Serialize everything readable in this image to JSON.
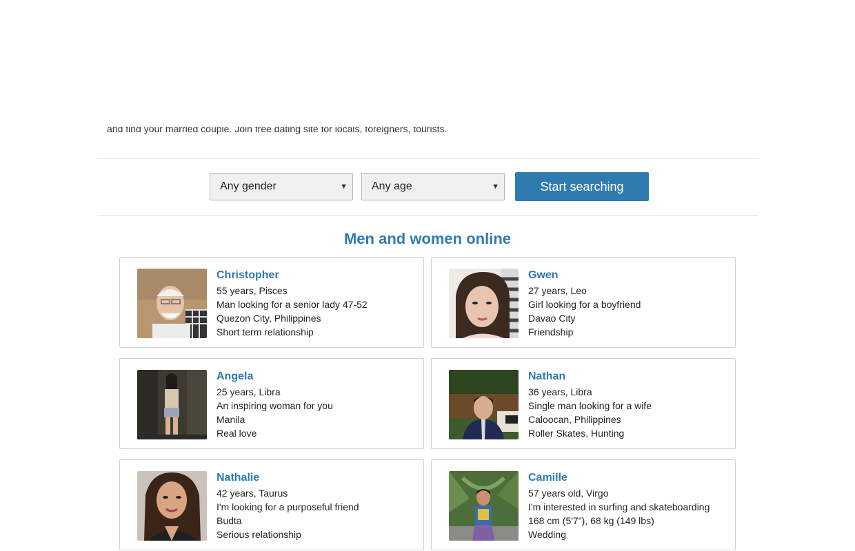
{
  "intro": {
    "text": "and find your married couple. Join free dating site for locals, foreigners, tourists."
  },
  "search": {
    "gender": {
      "selected": "Any gender"
    },
    "age": {
      "selected": "Any age"
    },
    "button_label": "Start searching"
  },
  "section_title": "Men and women online",
  "profiles": [
    {
      "name": "Christopher",
      "age_sign": "55 years, Pisces",
      "headline": "Man looking for a senior lady 47-52",
      "location": "Quezon City, Philippines",
      "goal": "Short term relationship"
    },
    {
      "name": "Gwen",
      "age_sign": "27 years, Leo",
      "headline": "Girl looking for a boyfriend",
      "location": "Davao City",
      "goal": "Friendship"
    },
    {
      "name": "Angela",
      "age_sign": "25 years, Libra",
      "headline": "An inspiring woman for you",
      "location": "Manila",
      "goal": "Real love"
    },
    {
      "name": "Nathan",
      "age_sign": "36 years, Libra",
      "headline": "Single man looking for a wife",
      "location": "Caloocan, Philippines",
      "goal": "Roller Skates, Hunting"
    },
    {
      "name": "Nathalie",
      "age_sign": "42 years, Taurus",
      "headline": "I'm looking for a purposeful friend",
      "location": "Budta",
      "goal": "Serious relationship"
    },
    {
      "name": "Camille",
      "age_sign": "57 years old, Virgo",
      "headline": "I'm interested in surfing and skateboarding",
      "location": "168 cm (5'7\"), 68 kg (149 lbs)",
      "goal": "Wedding"
    }
  ],
  "colors": {
    "accent": "#2f7bb0",
    "text": "#222222",
    "border": "#d0d0d0"
  }
}
